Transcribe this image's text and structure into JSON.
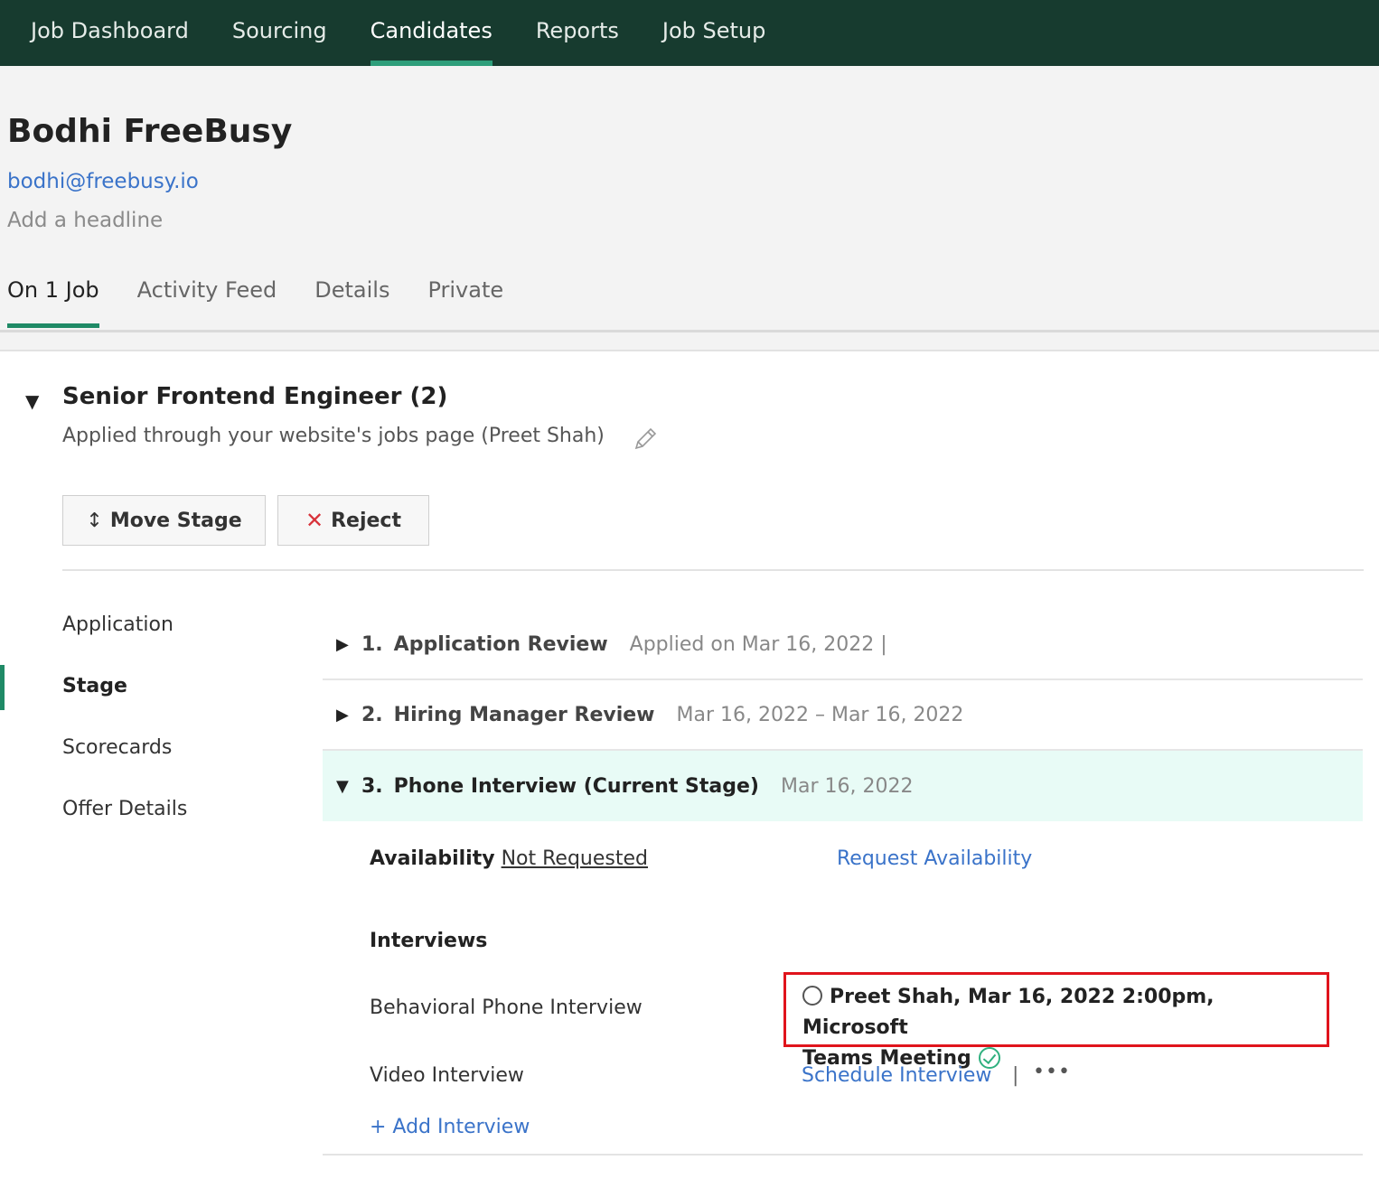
{
  "topnav": {
    "items": [
      {
        "label": "Job Dashboard",
        "active": false
      },
      {
        "label": "Sourcing",
        "active": false
      },
      {
        "label": "Candidates",
        "active": true
      },
      {
        "label": "Reports",
        "active": false
      },
      {
        "label": "Job Setup",
        "active": false
      }
    ]
  },
  "candidate": {
    "name": "Bodhi FreeBusy",
    "email": "bodhi@freebusy.io",
    "headline_placeholder": "Add a headline"
  },
  "subtabs": [
    {
      "label": "On 1 Job",
      "active": true
    },
    {
      "label": "Activity Feed",
      "active": false
    },
    {
      "label": "Details",
      "active": false
    },
    {
      "label": "Private",
      "active": false
    }
  ],
  "job": {
    "title": "Senior Frontend Engineer (2)",
    "source": "Applied through your website's jobs page (Preet Shah)",
    "move_stage_label": "Move Stage",
    "reject_label": "Reject"
  },
  "side_menu": [
    {
      "label": "Application",
      "active": false
    },
    {
      "label": "Stage",
      "active": true
    },
    {
      "label": "Scorecards",
      "active": false
    },
    {
      "label": "Offer Details",
      "active": false
    }
  ],
  "stages": [
    {
      "num": "1.",
      "name": "Application Review",
      "date": "Applied on Mar 16, 2022 |",
      "expanded": false
    },
    {
      "num": "2.",
      "name": "Hiring Manager Review",
      "date": "Mar 16, 2022 – Mar 16, 2022",
      "expanded": false
    },
    {
      "num": "3.",
      "name": "Phone Interview (Current Stage)",
      "date": "Mar 16, 2022",
      "expanded": true
    }
  ],
  "availability": {
    "label": "Availability",
    "status": "Not Requested",
    "action": "Request Availability"
  },
  "interviews": {
    "heading": "Interviews",
    "items": [
      {
        "name": "Behavioral Phone Interview",
        "detail_line1": "Preet Shah, Mar 16, 2022 2:00pm, Microsoft",
        "detail_line2": "Teams Meeting"
      },
      {
        "name": "Video Interview",
        "action": "Schedule Interview",
        "separator": "|"
      }
    ],
    "add_label": "+ Add Interview"
  },
  "colors": {
    "nav_bg": "#173b2f",
    "accent": "#1f8a66",
    "link": "#3a73c9",
    "highlight": "#e0141c",
    "current_stage_bg": "#e8fbf6"
  }
}
